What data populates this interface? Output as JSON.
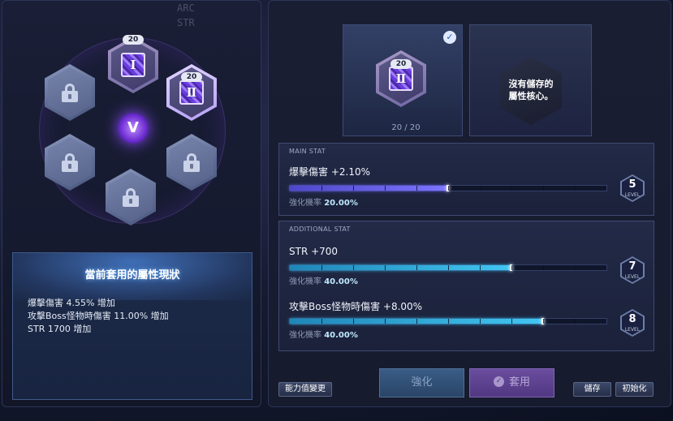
{
  "background_stats": [
    "ARC",
    "STR"
  ],
  "hex_grid": {
    "core_1": {
      "numeral": "Ⅰ",
      "level": "20"
    },
    "core_2": {
      "numeral": "Ⅱ",
      "level": "20"
    },
    "emblem": "V"
  },
  "current_status": {
    "title": "當前套用的屬性現狀",
    "lines": [
      "爆擊傷害 4.55% 增加",
      "攻擊Boss怪物時傷害 11.00% 增加",
      "STR 1700 增加"
    ]
  },
  "equipped_core": {
    "numeral": "Ⅱ",
    "level": "20",
    "count": "20 / 20"
  },
  "empty_slot": {
    "text_line1": "沒有儲存的",
    "text_line2": "屬性核心。"
  },
  "main_stat": {
    "section_label": "MAIN STAT",
    "name": "爆擊傷害 +2.10%",
    "rate_label": "強化機率",
    "rate_value": "20.00%",
    "level": "5",
    "level_label": "LEVEL",
    "progress": 0.5
  },
  "additional_stat": {
    "section_label": "ADDITIONAL STAT",
    "items": [
      {
        "name": "STR +700",
        "rate_label": "強化機率",
        "rate_value": "40.00%",
        "level": "7",
        "level_label": "LEVEL",
        "progress": 0.7
      },
      {
        "name": "攻擊Boss怪物時傷害 +8.00%",
        "rate_label": "強化機率",
        "rate_value": "40.00%",
        "level": "8",
        "level_label": "LEVEL",
        "progress": 0.8
      }
    ]
  },
  "buttons": {
    "stat_change": "能力值變更",
    "enhance": "強化",
    "apply": "套用",
    "save": "儲存",
    "reset": "初始化"
  },
  "colors": {
    "accent_purple": "#7d74ff",
    "accent_cyan": "#42c6f2"
  }
}
